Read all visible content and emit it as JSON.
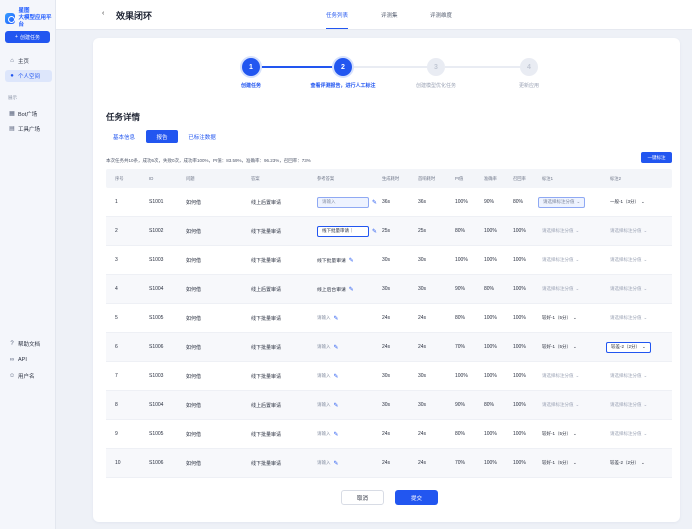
{
  "sidebar": {
    "logo_line1": "星图",
    "logo_line2": "大模型应用平台",
    "new_task_label": "创建任务",
    "items": [
      {
        "label": "主页",
        "icon": "home-icon"
      },
      {
        "label": "个人空间",
        "icon": "user-icon"
      }
    ],
    "section_label": "展示",
    "section_items": [
      {
        "label": "Bot广场",
        "icon": "grid-icon"
      },
      {
        "label": "工具广场",
        "icon": "tool-icon"
      }
    ],
    "bottom_items": [
      {
        "label": "帮助文档",
        "icon": "help-icon"
      },
      {
        "label": "API",
        "icon": "link-icon"
      },
      {
        "label": "用户名",
        "icon": "person-icon"
      }
    ]
  },
  "header": {
    "title": "效果闭环",
    "tabs": [
      {
        "label": "任务列表",
        "active": true
      },
      {
        "label": "评测集",
        "active": false
      },
      {
        "label": "评测维度",
        "active": false
      }
    ]
  },
  "stepper": {
    "steps": [
      {
        "num": "1",
        "label": "创建任务",
        "done": true
      },
      {
        "num": "2",
        "label": "查看评测报告，进行人工标注",
        "done": true
      },
      {
        "num": "3",
        "label": "创建模型优化任务",
        "done": false
      },
      {
        "num": "4",
        "label": "更新应用",
        "done": false
      }
    ]
  },
  "detail": {
    "title": "任务详情",
    "tabs": [
      {
        "label": "基本信息",
        "active": false
      },
      {
        "label": "报告",
        "active": true
      },
      {
        "label": "已标注数据",
        "active": false
      }
    ],
    "summary": "本次任务共10条，成功6次，失败0次，成功率100%，PI值：83.59%，准确率：96.23%，召回率：73%",
    "batch_button": "一键标注"
  },
  "table": {
    "columns": [
      "序号",
      "ID",
      "问题",
      "答案",
      "参考答案",
      "生成耗时",
      "首响耗时",
      "PI值",
      "准确率",
      "召回率",
      "标注1",
      "标注2"
    ],
    "rows": [
      {
        "no": "1",
        "id": "S1001",
        "question": "如何借",
        "answer": "线上后置审请",
        "ref": "请输入",
        "ref_state": "input",
        "gen": "36s",
        "first": "36s",
        "pi": "100%",
        "acc": "90%",
        "rec": "80%",
        "l1": "请选择标注分值",
        "l1_state": "hl",
        "l2": "一般-1（3分）",
        "l2_state": "val"
      },
      {
        "no": "2",
        "id": "S1002",
        "question": "如何借",
        "answer": "线下批量审请",
        "ref": "线下批量审请｜",
        "ref_state": "filled",
        "gen": "25s",
        "first": "25s",
        "pi": "80%",
        "acc": "100%",
        "rec": "100%",
        "l1": "请选择标注分值",
        "l1_state": "plain",
        "l2": "请选择标注分值",
        "l2_state": "plain"
      },
      {
        "no": "3",
        "id": "S1003",
        "question": "如何借",
        "answer": "线下批量审请",
        "ref": "线下批量审请",
        "ref_state": "text",
        "gen": "30s",
        "first": "30s",
        "pi": "100%",
        "acc": "100%",
        "rec": "100%",
        "l1": "请选择标注分值",
        "l1_state": "plain",
        "l2": "请选择标注分值",
        "l2_state": "plain"
      },
      {
        "no": "4",
        "id": "S1004",
        "question": "如何借",
        "answer": "线上后置审请",
        "ref": "线上后台审请",
        "ref_state": "text",
        "gen": "30s",
        "first": "30s",
        "pi": "90%",
        "acc": "80%",
        "rec": "100%",
        "l1": "请选择标注分值",
        "l1_state": "plain",
        "l2": "请选择标注分值",
        "l2_state": "plain"
      },
      {
        "no": "5",
        "id": "S1005",
        "question": "如何借",
        "answer": "线下批量审请",
        "ref": "请输入",
        "ref_state": "empty",
        "gen": "24s",
        "first": "24s",
        "pi": "80%",
        "acc": "100%",
        "rec": "100%",
        "l1": "较好-1（5分）",
        "l1_state": "val",
        "l2": "请选择标注分值",
        "l2_state": "plain"
      },
      {
        "no": "6",
        "id": "S1006",
        "question": "如何借",
        "answer": "线下批量审请",
        "ref": "请输入",
        "ref_state": "empty",
        "gen": "24s",
        "first": "24s",
        "pi": "70%",
        "acc": "100%",
        "rec": "100%",
        "l1": "较好-1（5分）",
        "l1_state": "val",
        "l2": "较差-2（2分）",
        "l2_state": "hl-strong"
      },
      {
        "no": "7",
        "id": "S1003",
        "question": "如何借",
        "answer": "线下批量审请",
        "ref": "请输入",
        "ref_state": "empty",
        "gen": "30s",
        "first": "30s",
        "pi": "100%",
        "acc": "100%",
        "rec": "100%",
        "l1": "请选择标注分值",
        "l1_state": "plain",
        "l2": "请选择标注分值",
        "l2_state": "plain"
      },
      {
        "no": "8",
        "id": "S1004",
        "question": "如何借",
        "answer": "线上后置审请",
        "ref": "请输入",
        "ref_state": "empty",
        "gen": "30s",
        "first": "30s",
        "pi": "90%",
        "acc": "80%",
        "rec": "100%",
        "l1": "请选择标注分值",
        "l1_state": "plain",
        "l2": "请选择标注分值",
        "l2_state": "plain"
      },
      {
        "no": "9",
        "id": "S1005",
        "question": "如何借",
        "answer": "线下批量审请",
        "ref": "请输入",
        "ref_state": "empty",
        "gen": "24s",
        "first": "24s",
        "pi": "80%",
        "acc": "100%",
        "rec": "100%",
        "l1": "较好-1（5分）",
        "l1_state": "val",
        "l2": "请选择标注分值",
        "l2_state": "plain"
      },
      {
        "no": "10",
        "id": "S1006",
        "question": "如何借",
        "answer": "线下批量审请",
        "ref": "请输入",
        "ref_state": "empty",
        "gen": "24s",
        "first": "24s",
        "pi": "70%",
        "acc": "100%",
        "rec": "100%",
        "l1": "较好-1（5分）",
        "l1_state": "val",
        "l2": "较差-2（2分）",
        "l2_state": "val"
      }
    ]
  },
  "footer": {
    "cancel_label": "取消",
    "submit_label": "提交"
  }
}
